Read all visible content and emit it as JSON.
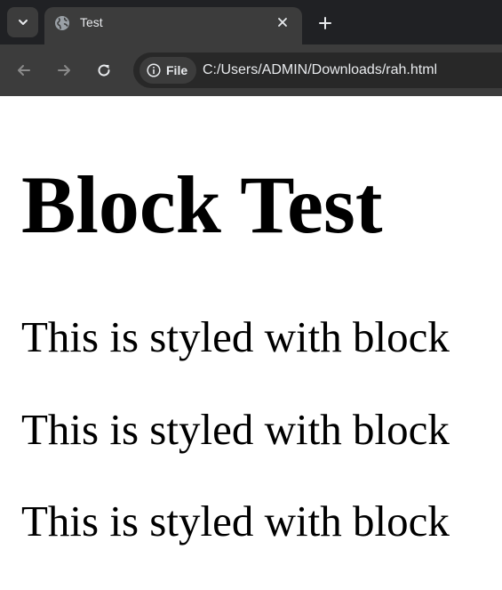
{
  "browser": {
    "tab": {
      "title": "Test"
    },
    "address_bar": {
      "chip_label": "File",
      "url": "C:/Users/ADMIN/Downloads/rah.html"
    },
    "icons": {
      "tab_search": "chevron-down-icon",
      "favicon": "globe-icon",
      "tab_close": "close-icon",
      "new_tab": "plus-icon",
      "back": "arrow-left-icon",
      "forward": "arrow-right-icon",
      "reload": "reload-icon",
      "site_info": "info-icon"
    },
    "colors": {
      "tabstrip_bg": "#202124",
      "toolbar_bg": "#3c3c3c",
      "omnibox_bg": "#282828",
      "text_light": "#e8eaed",
      "icon_disabled": "#8a8a8a"
    }
  },
  "page": {
    "heading": "Block Test",
    "paragraphs": [
      "This is styled with block",
      "This is styled with block",
      "This is styled with block"
    ]
  }
}
